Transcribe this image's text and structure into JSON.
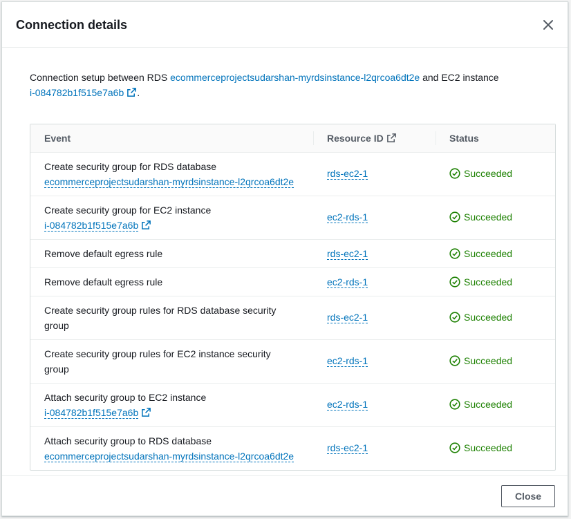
{
  "modal": {
    "title": "Connection details",
    "close_label": "Close"
  },
  "intro": {
    "prefix": "Connection setup between RDS ",
    "rds_link": "ecommerceprojectsudarshan-myrdsinstance-l2qrcoa6dt2e",
    "middle": " and EC2 instance",
    "ec2_link": "i-084782b1f515e7a6b",
    "suffix": "."
  },
  "table": {
    "headers": {
      "event": "Event",
      "resource_id": "Resource ID",
      "status": "Status"
    },
    "rows": [
      {
        "event": "Create security group for RDS database",
        "event_link": "ecommerceprojectsudarshan-myrdsinstance-l2qrcoa6dt2e",
        "resource_id": "rds-ec2-1",
        "status": "Succeeded"
      },
      {
        "event": "Create security group for EC2 instance",
        "event_link": "i-084782b1f515e7a6b",
        "resource_id": "ec2-rds-1",
        "status": "Succeeded"
      },
      {
        "event": "Remove default egress rule",
        "resource_id": "rds-ec2-1",
        "status": "Succeeded"
      },
      {
        "event": "Remove default egress rule",
        "resource_id": "ec2-rds-1",
        "status": "Succeeded"
      },
      {
        "event": "Create security group rules for RDS database security group",
        "resource_id": "rds-ec2-1",
        "status": "Succeeded"
      },
      {
        "event": "Create security group rules for EC2 instance security group",
        "resource_id": "ec2-rds-1",
        "status": "Succeeded"
      },
      {
        "event": "Attach security group to EC2 instance",
        "event_link": "i-084782b1f515e7a6b",
        "resource_id": "ec2-rds-1",
        "status": "Succeeded"
      },
      {
        "event": "Attach security group to RDS database",
        "event_link": "ecommerceprojectsudarshan-myrdsinstance-l2qrcoa6dt2e",
        "resource_id": "rds-ec2-1",
        "status": "Succeeded"
      }
    ]
  },
  "colors": {
    "link": "#0073bb",
    "success": "#1d8102"
  },
  "icons": {
    "close": "close-icon",
    "external": "external-link-icon",
    "success": "success-check-icon"
  }
}
